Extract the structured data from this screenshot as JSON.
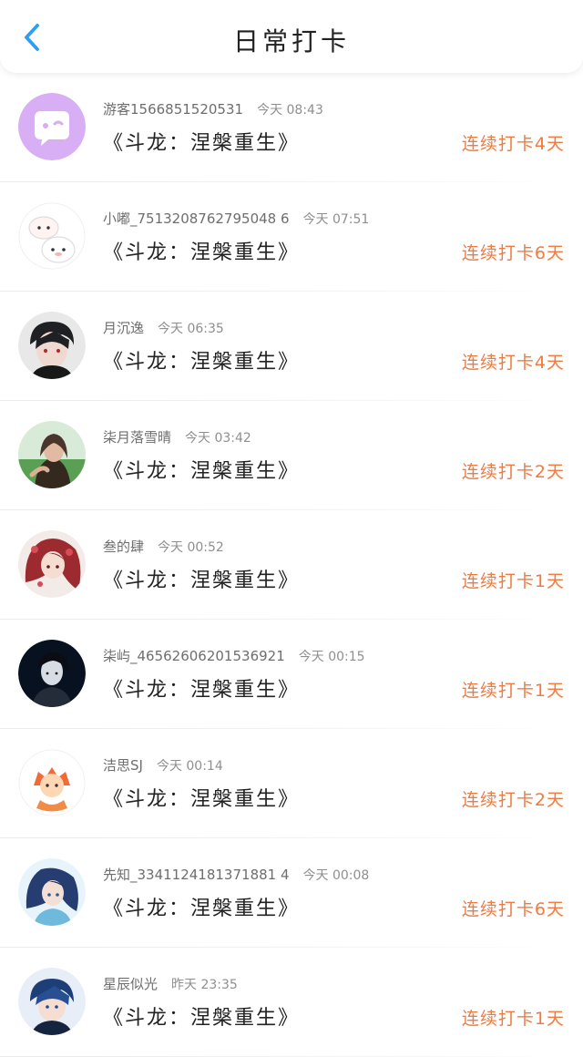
{
  "header": {
    "title": "日常打卡"
  },
  "colors": {
    "back": "#2d9ef1",
    "accent": "#ef7b42"
  },
  "entries": [
    {
      "username": "游客1566851520531",
      "time": "今天 08:43",
      "book": "《斗龙：涅槃重生》",
      "streak": "连续打卡4天",
      "avatar_icon": "chat-bubble-avatar-icon"
    },
    {
      "username": "小嘟_7513208762795048 6",
      "time": "今天 07:51",
      "book": "《斗龙：涅槃重生》",
      "streak": "连续打卡6天",
      "avatar_icon": "cartoon-pets-avatar-icon"
    },
    {
      "username": "月沉逸",
      "time": "今天 06:35",
      "book": "《斗龙：涅槃重生》",
      "streak": "连续打卡4天",
      "avatar_icon": "dark-hair-boy-avatar-icon"
    },
    {
      "username": "柒月落雪晴",
      "time": "今天 03:42",
      "book": "《斗龙：涅槃重生》",
      "streak": "连续打卡2天",
      "avatar_icon": "outdoor-girl-avatar-icon"
    },
    {
      "username": "叁的肆",
      "time": "今天 00:52",
      "book": "《斗龙：涅槃重生》",
      "streak": "连续打卡1天",
      "avatar_icon": "anime-girl-avatar-icon"
    },
    {
      "username": "柒屿_46562606201536921",
      "time": "今天 00:15",
      "book": "《斗龙：涅槃重生》",
      "streak": "连续打卡1天",
      "avatar_icon": "dark-portrait-avatar-icon"
    },
    {
      "username": "洁思SJ",
      "time": "今天 00:14",
      "book": "《斗龙：涅槃重生》",
      "streak": "连续打卡2天",
      "avatar_icon": "orange-cartoon-avatar-icon"
    },
    {
      "username": "先知_3341124181371881 4",
      "time": "今天 00:08",
      "book": "《斗龙：涅槃重生》",
      "streak": "连续打卡6天",
      "avatar_icon": "blue-anime-avatar-icon"
    },
    {
      "username": "星辰似光",
      "time": "昨天 23:35",
      "book": "《斗龙：涅槃重生》",
      "streak": "连续打卡1天",
      "avatar_icon": "blue-hair-boy-avatar-icon"
    }
  ]
}
